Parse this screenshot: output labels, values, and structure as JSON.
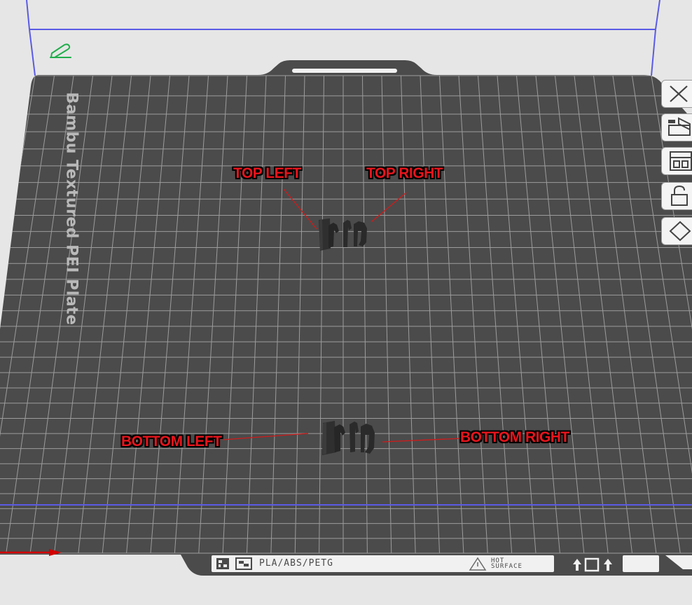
{
  "viewport": {
    "plate_name": "Bambu Textured PEI Plate",
    "plate_rename_icon": "pencil-icon"
  },
  "callouts": {
    "top_left": "TOP LEFT",
    "top_right": "TOP RIGHT",
    "bottom_left": "BOTTOM LEFT",
    "bottom_right": "BOTTOM RIGHT"
  },
  "plate_info": {
    "filament_types": "PLA/ABS/PETG",
    "warning_line1": "HOT",
    "warning_line2": "SURFACE"
  },
  "side_toolbar": {
    "items": [
      "close-icon",
      "auto-orient-icon",
      "arrange-icon",
      "lock-icon",
      "settings-icon"
    ]
  },
  "colors": {
    "bed": "#4b4b4b",
    "grid": "#9c9c9c",
    "build_volume": "#5a5ae6",
    "callout_text": "#e8141c",
    "leader_line": "#d11a1a",
    "x_axis": "#d20000",
    "edit_icon": "#1fae4b"
  }
}
